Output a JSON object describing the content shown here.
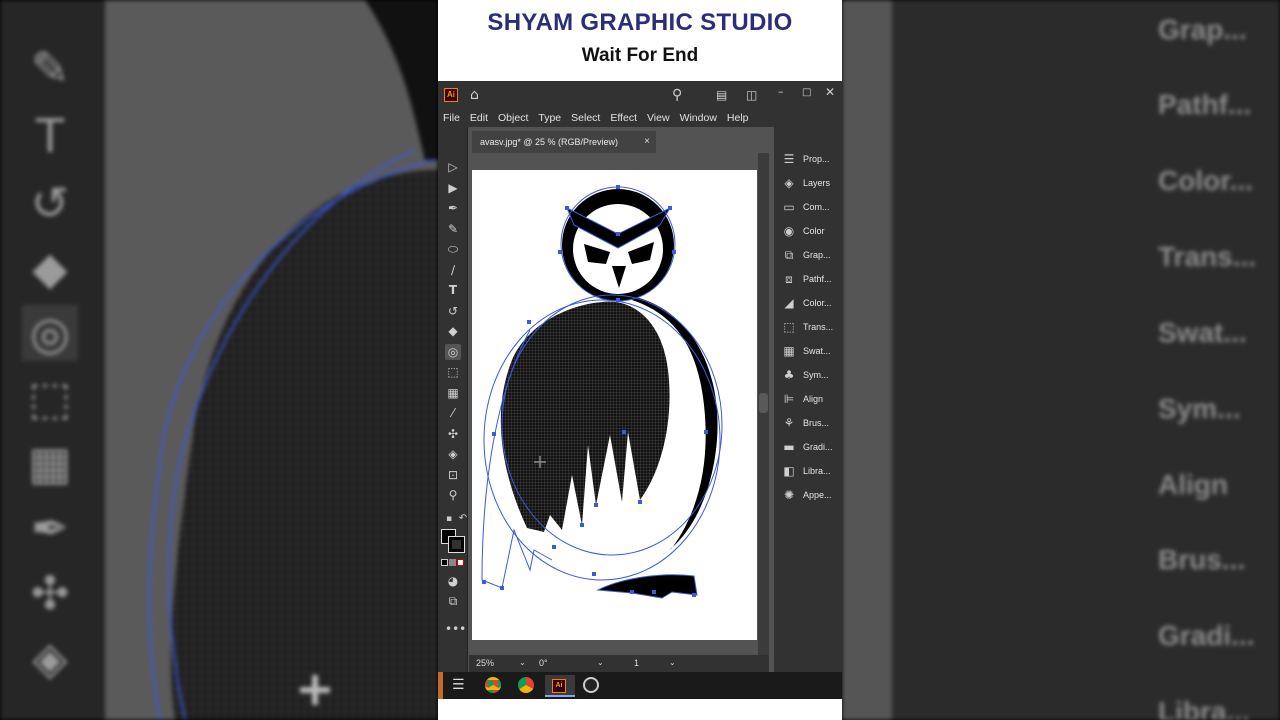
{
  "banner": {
    "title": "SHYAM GRAPHIC STUDIO",
    "subtitle": "Wait For End"
  },
  "app": {
    "logo": "Ai",
    "menu": [
      "File",
      "Edit",
      "Object",
      "Type",
      "Select",
      "Effect",
      "View",
      "Window",
      "Help"
    ],
    "document_tab": "avasv.jpg* @ 25 % (RGB/Preview)",
    "close_glyph": "×",
    "status": {
      "zoom": "25%",
      "rotation": "0°",
      "artboard": "1"
    },
    "tools": [
      "selection-tool",
      "direct-selection-tool",
      "pen-tool",
      "curvature-tool",
      "ellipse-tool",
      "paintbrush-tool",
      "type-tool",
      "rotate-tool",
      "eraser-tool",
      "shape-builder-tool",
      "free-transform-tool",
      "gradient-tool",
      "eyedropper-tool",
      "puppet-warp-tool",
      "blend-tool",
      "artboard-tool",
      "zoom-tool"
    ],
    "panels": [
      {
        "label": "Prop...",
        "icon": "properties-icon"
      },
      {
        "label": "Layers",
        "icon": "layers-icon"
      },
      {
        "label": "Com...",
        "icon": "comments-icon"
      },
      {
        "label": "Color",
        "icon": "color-icon"
      },
      {
        "label": "Grap...",
        "icon": "graphic-styles-icon"
      },
      {
        "label": "Pathf...",
        "icon": "pathfinder-icon"
      },
      {
        "label": "Color...",
        "icon": "color-guide-icon"
      },
      {
        "label": "Trans...",
        "icon": "transform-icon"
      },
      {
        "label": "Swat...",
        "icon": "swatches-icon"
      },
      {
        "label": "Sym...",
        "icon": "symbols-icon"
      },
      {
        "label": "Align",
        "icon": "align-icon"
      },
      {
        "label": "Brus...",
        "icon": "brushes-icon"
      },
      {
        "label": "Gradi...",
        "icon": "gradient-icon"
      },
      {
        "label": "Libra...",
        "icon": "libraries-icon"
      },
      {
        "label": "Appe...",
        "icon": "appearance-icon"
      }
    ]
  },
  "background_right_panels": [
    "Grap...",
    "Pathf...",
    "Color...",
    "Trans...",
    "Swat...",
    "Sym...",
    "Align",
    "Brus...",
    "Gradi...",
    "Libra..."
  ],
  "colors": {
    "banner_title": "#2a2e7a",
    "path_stroke": "#3b5bdb",
    "artwork_fill": "#111111"
  }
}
